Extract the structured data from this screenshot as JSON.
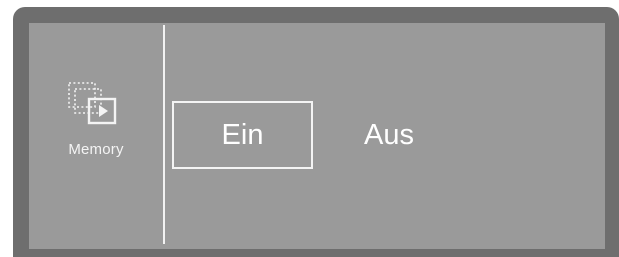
{
  "sidebar": {
    "icon": "memory-icon",
    "label": "Memory"
  },
  "options": {
    "on_label": "Ein",
    "off_label": "Aus",
    "selected": "Ein"
  }
}
